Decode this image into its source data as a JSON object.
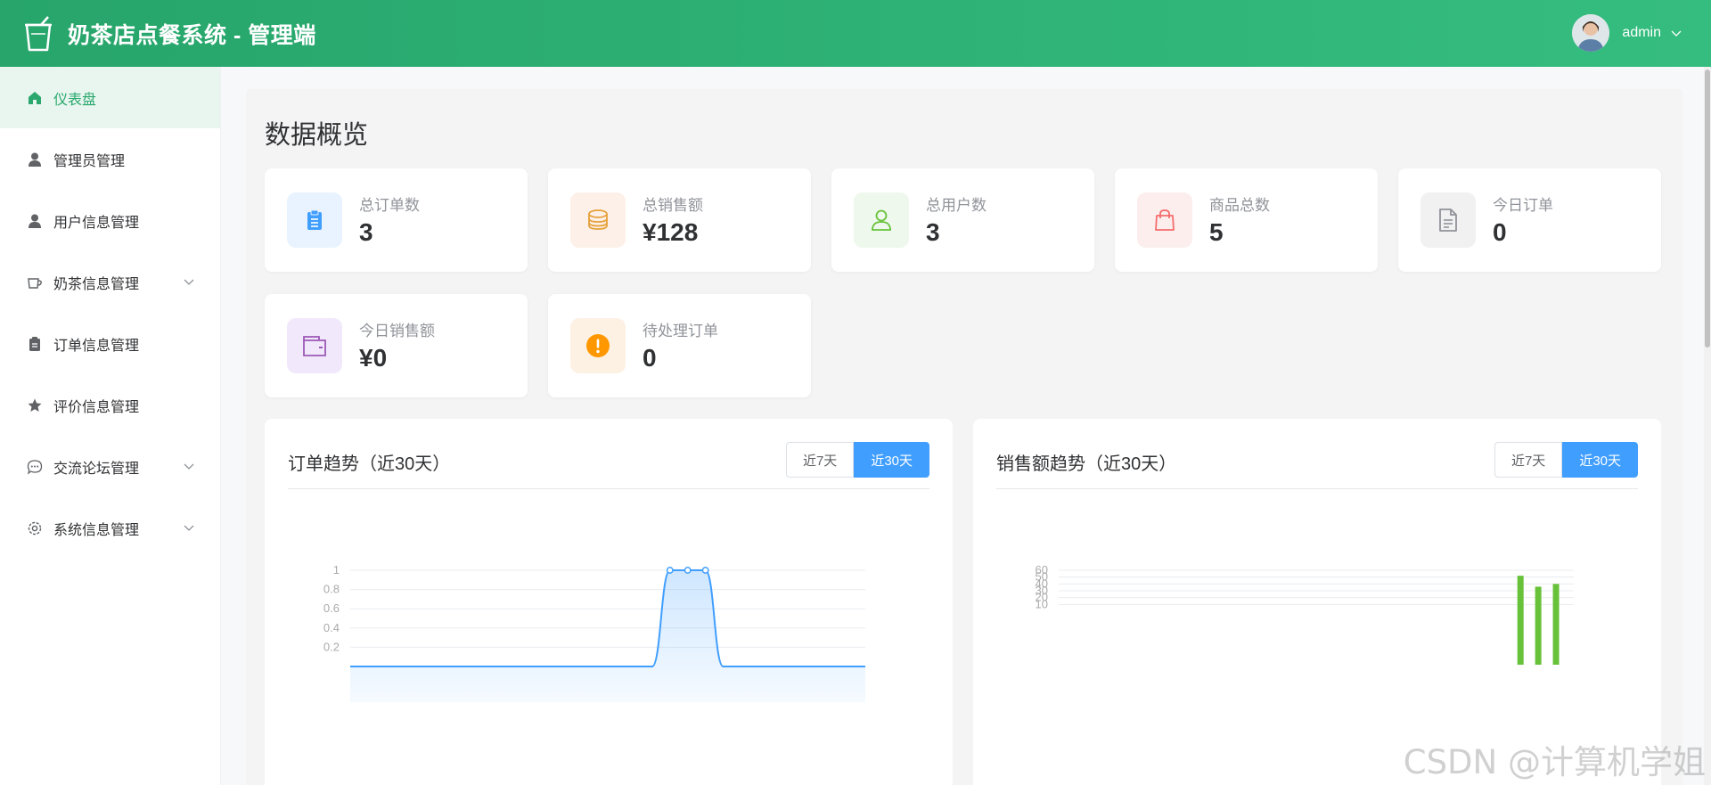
{
  "header": {
    "app_title": "奶茶店点餐系统 - 管理端",
    "user_name": "admin",
    "logo_icon": "cup-icon"
  },
  "sidebar": {
    "items": [
      {
        "label": "仪表盘",
        "icon": "home-icon",
        "active": true,
        "expandable": false
      },
      {
        "label": "管理员管理",
        "icon": "user-icon",
        "active": false,
        "expandable": false
      },
      {
        "label": "用户信息管理",
        "icon": "user-icon",
        "active": false,
        "expandable": false
      },
      {
        "label": "奶茶信息管理",
        "icon": "cup-icon",
        "active": false,
        "expandable": true
      },
      {
        "label": "订单信息管理",
        "icon": "clipboard-icon",
        "active": false,
        "expandable": false
      },
      {
        "label": "评价信息管理",
        "icon": "star-icon",
        "active": false,
        "expandable": false
      },
      {
        "label": "交流论坛管理",
        "icon": "chat-icon",
        "active": false,
        "expandable": true
      },
      {
        "label": "系统信息管理",
        "icon": "gear-icon",
        "active": false,
        "expandable": true
      }
    ]
  },
  "main": {
    "page_title": "数据概览",
    "stats": [
      {
        "label": "总订单数",
        "value": "3",
        "icon": "clipboard-icon",
        "color": "#409eff",
        "bg": "#e8f3ff"
      },
      {
        "label": "总销售额",
        "value": "¥128",
        "icon": "coins-icon",
        "color": "#e6a23c",
        "bg": "#fdf0e8"
      },
      {
        "label": "总用户数",
        "value": "3",
        "icon": "user-icon",
        "color": "#67c23a",
        "bg": "#eef8ec"
      },
      {
        "label": "商品总数",
        "value": "5",
        "icon": "shopping-bag-icon",
        "color": "#f56c6c",
        "bg": "#fdeeee"
      },
      {
        "label": "今日订单",
        "value": "0",
        "icon": "document-icon",
        "color": "#909399",
        "bg": "#f1f1f2"
      },
      {
        "label": "今日销售额",
        "value": "¥0",
        "icon": "wallet-icon",
        "color": "#9b59b6",
        "bg": "#f1e8fb"
      },
      {
        "label": "待处理订单",
        "value": "0",
        "icon": "warning-icon",
        "color": "#ff9800",
        "bg": "#fdf1e4"
      }
    ],
    "charts": [
      {
        "title": "订单趋势（近30天）",
        "btn_7": "近7天",
        "btn_30": "近30天",
        "active": "30"
      },
      {
        "title": "销售额趋势（近30天）",
        "btn_7": "近7天",
        "btn_30": "近30天",
        "active": "30"
      }
    ]
  },
  "chart_data": [
    {
      "type": "area",
      "title": "订单趋势（近30天）",
      "ylim": [
        0,
        1
      ],
      "yticks": [
        "0.2",
        "0.4",
        "0.6",
        "0.8",
        "1"
      ],
      "series": [
        {
          "values": [
            0,
            0,
            0,
            0,
            0,
            0,
            0,
            0,
            0,
            0,
            0,
            0,
            0,
            0,
            0,
            0,
            0,
            0,
            1,
            1,
            1,
            0,
            0,
            0,
            0,
            0,
            0,
            0,
            0,
            0
          ]
        }
      ],
      "color": "#409eff",
      "grid": true
    },
    {
      "type": "bar",
      "title": "销售额趋势（近30天）",
      "ylim": [
        0,
        60
      ],
      "yticks": [
        "10",
        "20",
        "30",
        "40",
        "50",
        "60"
      ],
      "series": [
        {
          "values": [
            0,
            0,
            0,
            0,
            0,
            0,
            0,
            0,
            0,
            0,
            0,
            0,
            0,
            0,
            0,
            0,
            0,
            0,
            0,
            0,
            0,
            0,
            0,
            0,
            0,
            0,
            52,
            36,
            40,
            0
          ]
        }
      ],
      "color": "#67c23a",
      "grid": true
    }
  ],
  "watermark": "CSDN @计算机学姐"
}
